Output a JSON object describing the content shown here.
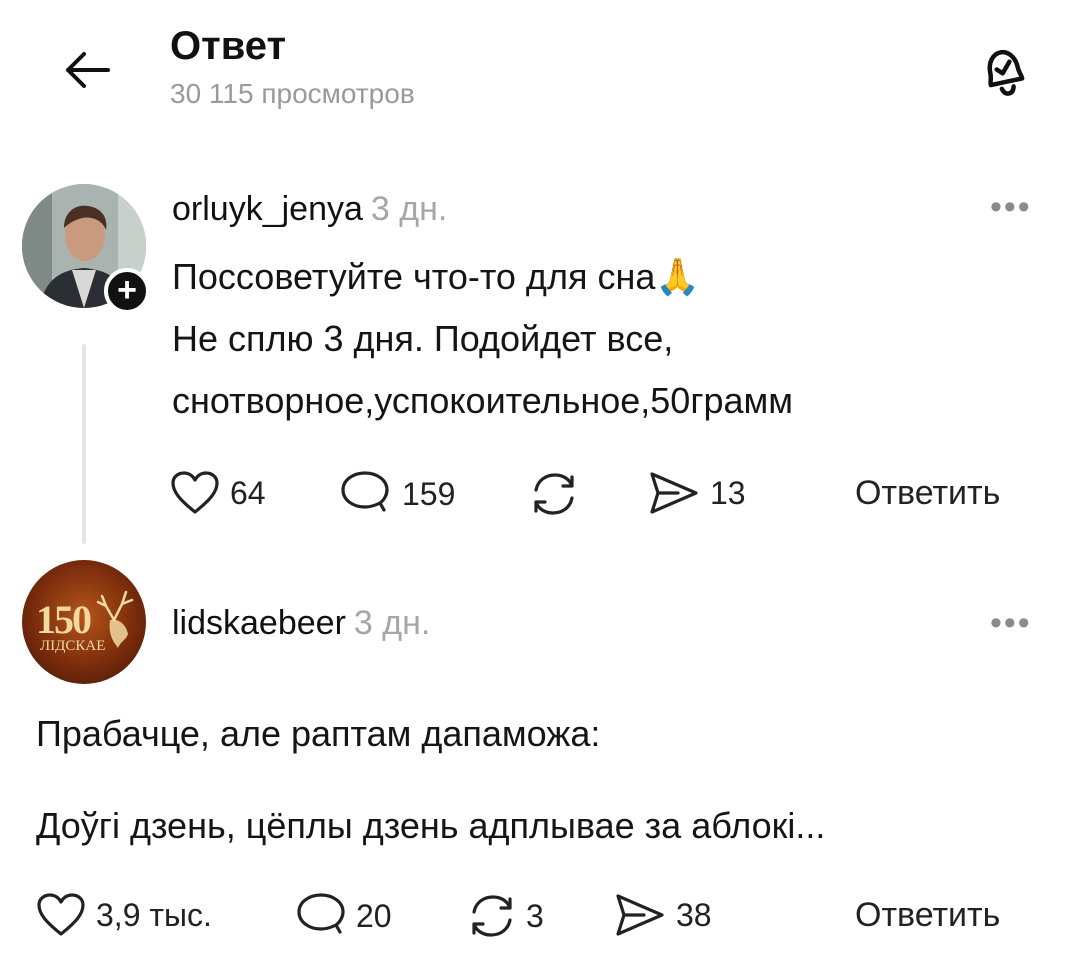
{
  "header": {
    "title": "Ответ",
    "views": "30 115 просмотров"
  },
  "posts": [
    {
      "username": "orluyk_jenya",
      "time": "3 дн.",
      "text_lines": [
        "Поссоветуйте что-то для сна🙏",
        "Не сплю 3 дня. Подойдет все,",
        "снотворное,успокоительное,50грамм"
      ],
      "likes": "64",
      "comments": "159",
      "reposts": "",
      "shares": "13",
      "reply_label": "Ответить"
    },
    {
      "username": "lidskaebeer",
      "time": "3 дн.",
      "avatar_logo": {
        "number": "150",
        "word": "ЛІДСКАЕ"
      },
      "text_lines": [
        "Прабачце, але раптам дапаможа:",
        "Доўгі дзень, цёплы дзень адплывае за аблокі..."
      ],
      "likes": "3,9 тыс.",
      "comments": "20",
      "reposts": "3",
      "shares": "38",
      "reply_label": "Ответить"
    }
  ],
  "icons": {
    "back": "arrow-left-icon",
    "bell": "bell-check-icon",
    "like": "heart-icon",
    "comment": "comment-icon",
    "repost": "repost-icon",
    "share": "send-icon",
    "more": "more-icon"
  }
}
